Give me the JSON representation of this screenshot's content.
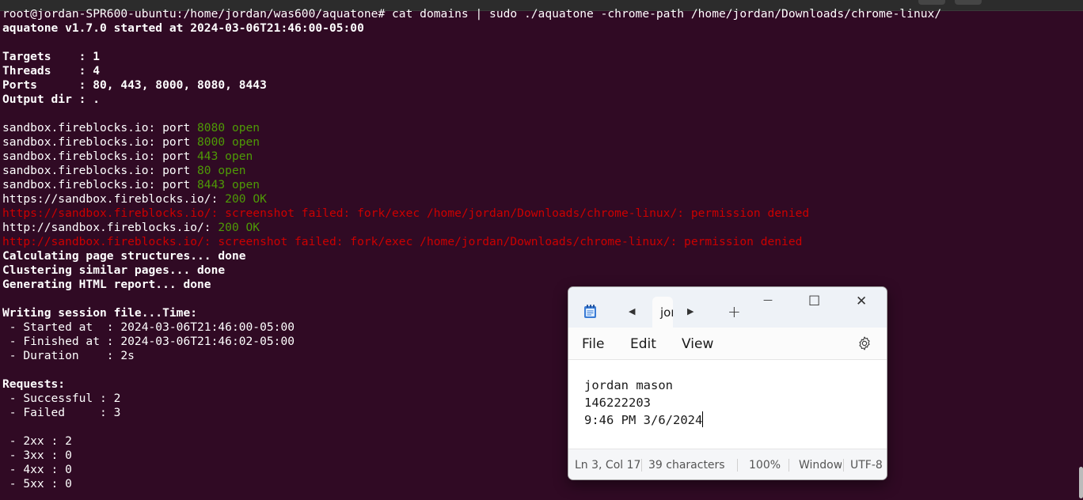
{
  "terminal": {
    "lines": [
      [
        {
          "t": "root@jordan-SPR600-ubuntu:/home/jordan/was600/aquatone# cat domains | sudo ./aquatone -chrome-path /home/jordan/Downloads/chrome-linux/",
          "c": "w"
        }
      ],
      [
        {
          "t": "aquatone v1.7.0 started at 2024-03-06T21:46:00-05:00",
          "c": "b"
        }
      ],
      [],
      [
        {
          "t": "Targets    : 1",
          "c": "b"
        }
      ],
      [
        {
          "t": "Threads    : 4",
          "c": "b"
        }
      ],
      [
        {
          "t": "Ports      : 80, 443, 8000, 8080, 8443",
          "c": "b"
        }
      ],
      [
        {
          "t": "Output dir : .",
          "c": "b"
        }
      ],
      [],
      [
        {
          "t": "sandbox.fireblocks.io: port ",
          "c": "w"
        },
        {
          "t": "8080 open",
          "c": "g"
        }
      ],
      [
        {
          "t": "sandbox.fireblocks.io: port ",
          "c": "w"
        },
        {
          "t": "8000 open",
          "c": "g"
        }
      ],
      [
        {
          "t": "sandbox.fireblocks.io: port ",
          "c": "w"
        },
        {
          "t": "443 open",
          "c": "g"
        }
      ],
      [
        {
          "t": "sandbox.fireblocks.io: port ",
          "c": "w"
        },
        {
          "t": "80 open",
          "c": "g"
        }
      ],
      [
        {
          "t": "sandbox.fireblocks.io: port ",
          "c": "w"
        },
        {
          "t": "8443 open",
          "c": "g"
        }
      ],
      [
        {
          "t": "https://sandbox.fireblocks.io/: ",
          "c": "w"
        },
        {
          "t": "200 OK",
          "c": "g"
        }
      ],
      [
        {
          "t": "https://sandbox.fireblocks.io/: screenshot failed: fork/exec /home/jordan/Downloads/chrome-linux/: permission denied",
          "c": "r"
        }
      ],
      [
        {
          "t": "http://sandbox.fireblocks.io/: ",
          "c": "w"
        },
        {
          "t": "200 OK",
          "c": "g"
        }
      ],
      [
        {
          "t": "http://sandbox.fireblocks.io/: screenshot failed: fork/exec /home/jordan/Downloads/chrome-linux/: permission denied",
          "c": "r"
        }
      ],
      [
        {
          "t": "Calculating page structures... done",
          "c": "b"
        }
      ],
      [
        {
          "t": "Clustering similar pages... done",
          "c": "b"
        }
      ],
      [
        {
          "t": "Generating HTML report... done",
          "c": "b"
        }
      ],
      [],
      [
        {
          "t": "Writing session file...Time:",
          "c": "b"
        }
      ],
      [
        {
          "t": " - Started at  : 2024-03-06T21:46:00-05:00",
          "c": "w"
        }
      ],
      [
        {
          "t": " - Finished at : 2024-03-06T21:46:02-05:00",
          "c": "w"
        }
      ],
      [
        {
          "t": " - Duration    : 2s",
          "c": "w"
        }
      ],
      [],
      [
        {
          "t": "Requests:",
          "c": "b"
        }
      ],
      [
        {
          "t": " - Successful : 2",
          "c": "w"
        }
      ],
      [
        {
          "t": " - Failed     : 3",
          "c": "w"
        }
      ],
      [],
      [
        {
          "t": " - 2xx : 2",
          "c": "w"
        }
      ],
      [
        {
          "t": " - 3xx : 0",
          "c": "w"
        }
      ],
      [
        {
          "t": " - 4xx : 0",
          "c": "w"
        }
      ],
      [
        {
          "t": " - 5xx : 0",
          "c": "w"
        }
      ]
    ]
  },
  "notepad": {
    "app_icon": "notepad-icon",
    "tab_title": "jordan",
    "controls": {
      "back": "◀",
      "forward": "▶",
      "new_tab": "+",
      "minimize": "—",
      "maximize": "☐",
      "close": "✕"
    },
    "menu": {
      "file": "File",
      "edit": "Edit",
      "view": "View",
      "settings_icon": "gear-icon"
    },
    "content": {
      "line1": "jordan mason",
      "line2": "146222203",
      "line3": "9:46 PM 3/6/2024"
    },
    "status": {
      "position": "Ln 3, Col 17",
      "chars": "39 characters",
      "zoom": "100%",
      "line_ending": "Windows (CRLF)",
      "encoding": "UTF-8"
    }
  },
  "colors": {
    "terminal_bg": "#300a24",
    "green": "#4e9a06",
    "red": "#cc0000",
    "white": "#ffffff"
  }
}
